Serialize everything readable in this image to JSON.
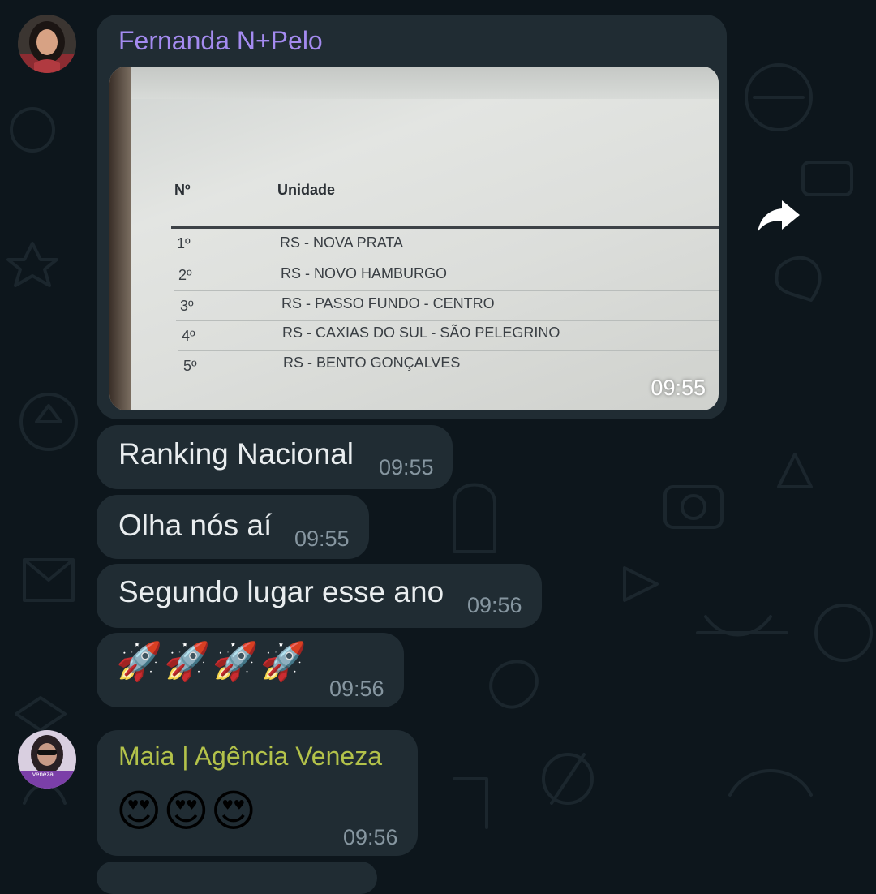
{
  "messages": [
    {
      "sender": "Fernanda N+Pelo",
      "sender_color": "#a48bf0",
      "photo": {
        "table_headers": [
          "Nº",
          "Unidade"
        ],
        "rows": [
          {
            "pos": "1º",
            "unit": "RS - NOVA PRATA"
          },
          {
            "pos": "2º",
            "unit": "RS - NOVO HAMBURGO"
          },
          {
            "pos": "3º",
            "unit": "RS - PASSO FUNDO - CENTRO"
          },
          {
            "pos": "4º",
            "unit": "RS - CAXIAS DO SUL - SÃO PELEGRINO"
          },
          {
            "pos": "5º",
            "unit": "RS - BENTO GONÇALVES"
          }
        ],
        "time": "09:55"
      },
      "texts": [
        {
          "text": "Ranking Nacional",
          "time": "09:55"
        },
        {
          "text": "Olha nós aí",
          "time": "09:55"
        },
        {
          "text": "Segundo lugar esse ano",
          "time": "09:56"
        }
      ],
      "emoji": {
        "text": "🚀🚀🚀🚀",
        "time": "09:56"
      }
    },
    {
      "sender": "Maia | Agência Veneza",
      "sender_color": "#b3c24a",
      "avatar_text": "veneza",
      "emoji": {
        "text": "😍😍😍",
        "time": "09:56"
      }
    }
  ],
  "icons": {
    "forward": "forward-icon"
  },
  "colors": {
    "bubble": "#202c33",
    "background": "#0d161c",
    "time": "#8696a0",
    "text": "#e9edef"
  }
}
